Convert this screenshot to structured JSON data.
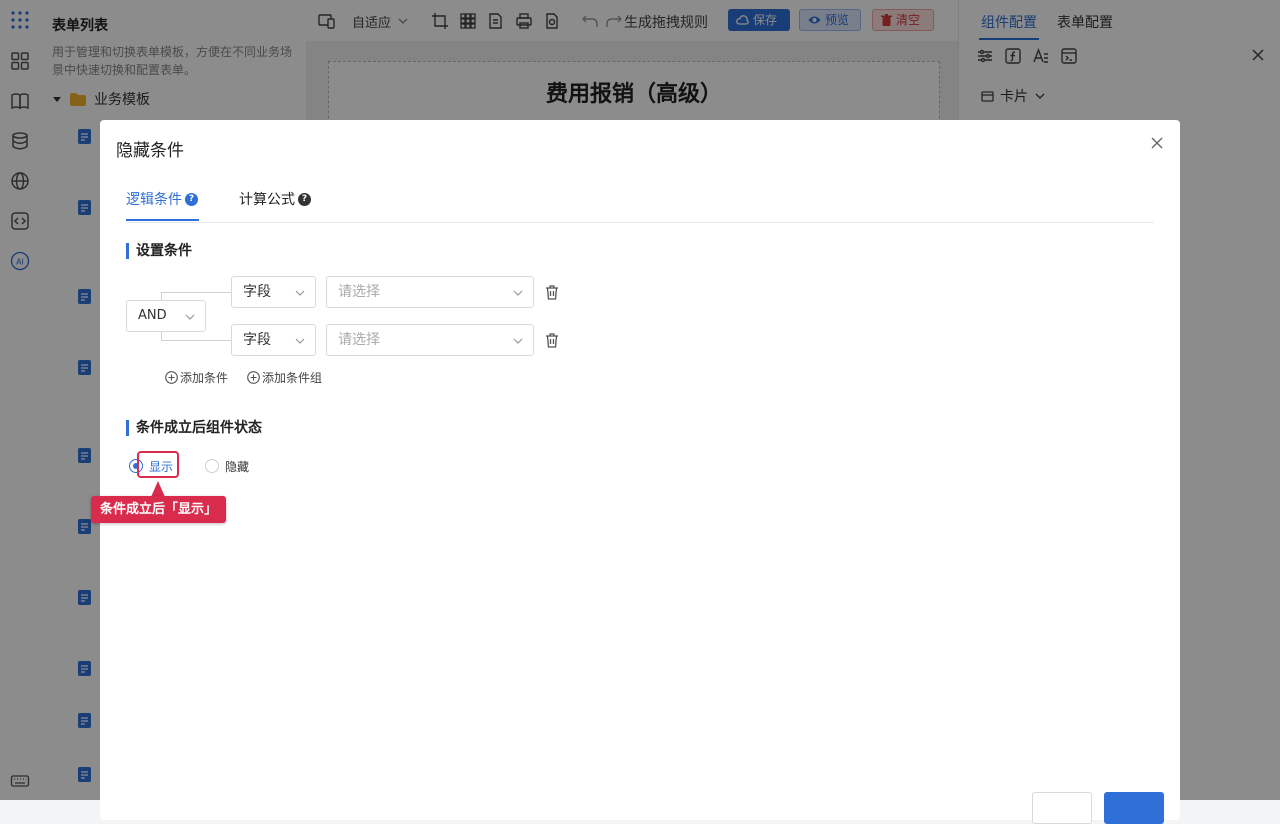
{
  "left_panel": {
    "title": "表单列表",
    "description": "用于管理和切换表单模板，方便在不同业务场景中快速切换和配置表单。",
    "group_label": "业务模板"
  },
  "toolbar": {
    "adapt_label": "自适应",
    "generate_rule_label": "生成拖拽规则",
    "save_label": "保存",
    "preview_label": "预览",
    "clear_label": "清空"
  },
  "canvas": {
    "form_title": "费用报销（高级）"
  },
  "right_panel": {
    "tab_component": "组件配置",
    "tab_form": "表单配置",
    "card_label": "卡片"
  },
  "modal": {
    "title": "隐藏条件",
    "tabs": [
      {
        "label": "逻辑条件",
        "active": true
      },
      {
        "label": "计算公式",
        "active": false
      }
    ],
    "section_conditions": "设置条件",
    "operator": "AND",
    "conditions": [
      {
        "field": "字段",
        "value_placeholder": "请选择"
      },
      {
        "field": "字段",
        "value_placeholder": "请选择"
      }
    ],
    "add_condition": "添加条件",
    "add_condition_group": "添加条件组",
    "section_state": "条件成立后组件状态",
    "state_options": [
      {
        "label": "显示",
        "selected": true
      },
      {
        "label": "隐藏",
        "selected": false
      }
    ],
    "annotation": "条件成立后「显示」"
  },
  "colors": {
    "primary": "#2f6fd8",
    "danger": "#d63b3b",
    "annotation": "#d92b4b"
  }
}
